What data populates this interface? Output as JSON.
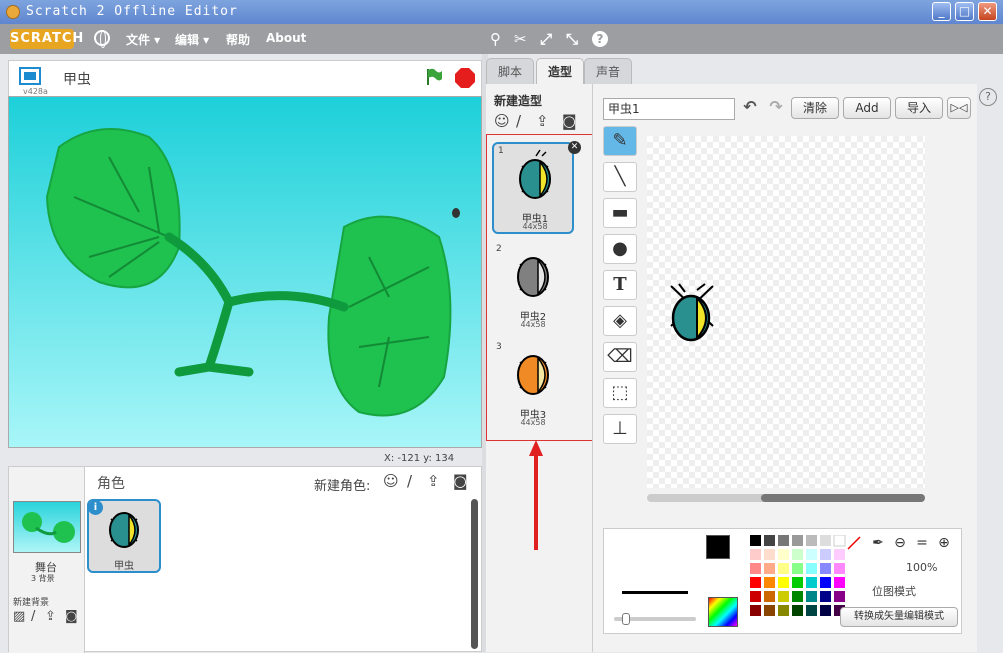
{
  "window": {
    "title": "Scratch 2 Offline Editor",
    "btn_min": "_",
    "btn_max": "□",
    "btn_close": "✕"
  },
  "menubar": {
    "logo": "SCRATCH",
    "file": "文件 ▾",
    "edit": "编辑 ▾",
    "help": "帮助",
    "about": "About"
  },
  "stage": {
    "version": "v428a",
    "sprite_name": "甲虫",
    "coords_label": "X: -121  y: 134"
  },
  "sprites_panel": {
    "header": "角色",
    "new_sprite": "新建角色:",
    "stage_label": "舞台",
    "stage_backdrops": "3 背景",
    "new_backdrop": "新建背景",
    "sprite": {
      "name": "甲虫",
      "info": "i"
    }
  },
  "tabs": [
    {
      "label": "脚本"
    },
    {
      "label": "造型"
    },
    {
      "label": "声音"
    }
  ],
  "costumes": {
    "new_costume": "新建造型",
    "items": [
      {
        "num": "1",
        "name": "甲虫1",
        "size": "44x58",
        "color": "#2a8f8f"
      },
      {
        "num": "2",
        "name": "甲虫2",
        "size": "44x58",
        "color": "#808080"
      },
      {
        "num": "3",
        "name": "甲虫3",
        "size": "44x58",
        "color": "#f08a24"
      }
    ]
  },
  "editor": {
    "costume_name": "甲虫1",
    "clear": "清除",
    "add": "Add",
    "import": "导入",
    "zoom": "100%",
    "mode_label": "位图模式",
    "convert": "转换成矢量编辑模式"
  },
  "colors": {
    "accent": "#2c8ecb",
    "highlight_box": "#dd3333",
    "menubar": "#9c9ea2"
  }
}
